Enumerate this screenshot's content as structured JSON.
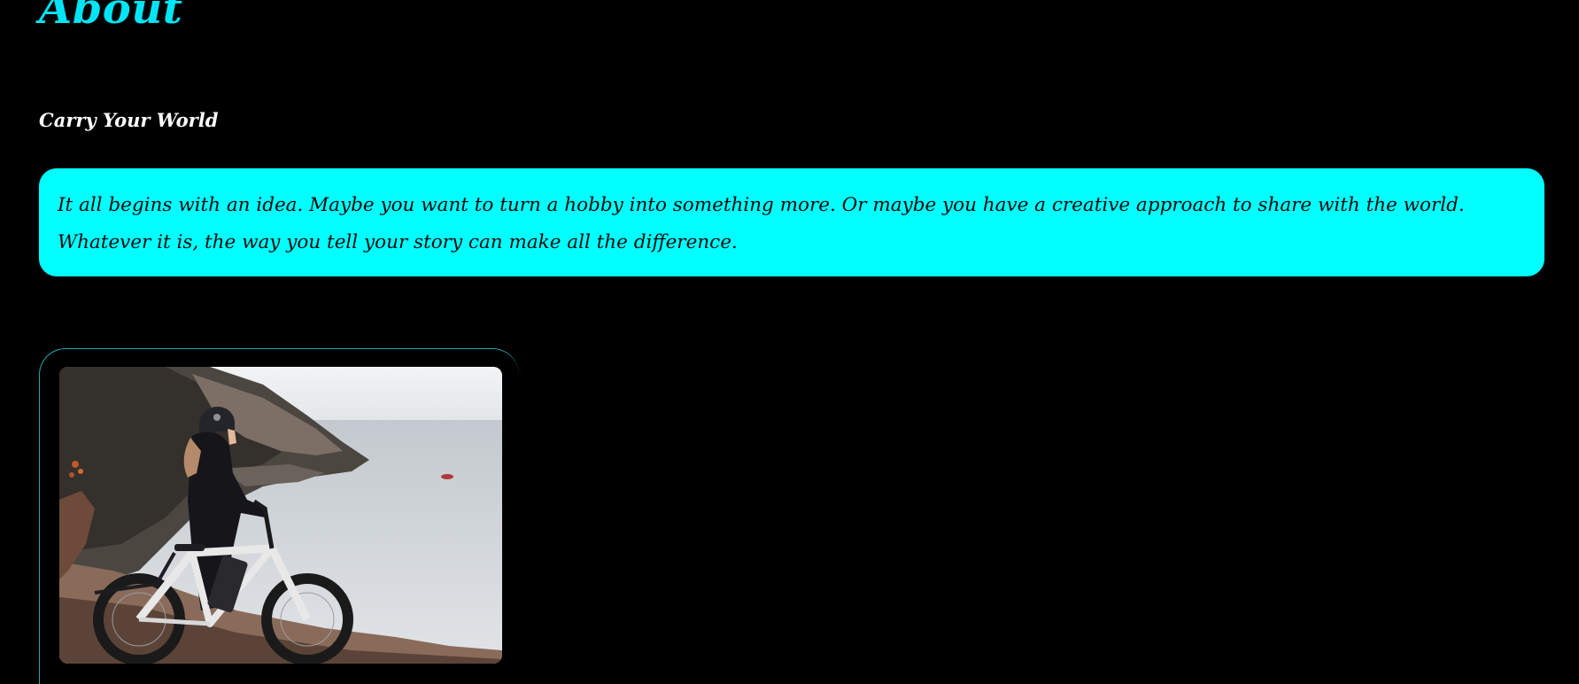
{
  "page": {
    "title": "About",
    "subtitle": "Carry Your World"
  },
  "callout": {
    "text": "It all begins with an idea. Maybe you want to turn a hobby into something more. Or maybe you have a creative approach to share with the world. Whatever it is, the way you tell your story can make all the difference."
  },
  "colors": {
    "background": "#000000",
    "accent": "#00ffff",
    "title": "#00e5f5",
    "frame_border": "#1fa9b0"
  }
}
